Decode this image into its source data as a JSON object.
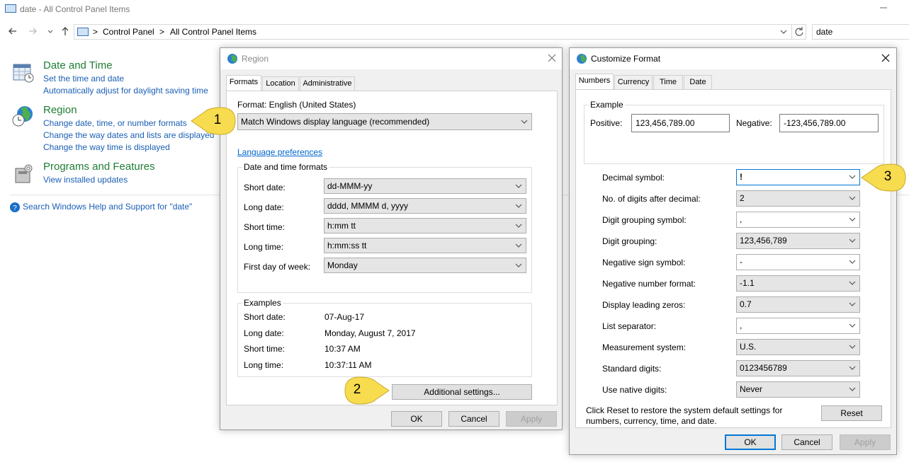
{
  "window": {
    "title": "date - All Control Panel Items"
  },
  "address": {
    "crumbs": [
      "Control Panel",
      "All Control Panel Items"
    ],
    "separator": ">",
    "search_value": "date"
  },
  "left_pane": {
    "sections": [
      {
        "heading": "Date and Time",
        "icon": "calendar-clock-icon",
        "links": [
          "Set the time and date",
          "Automatically adjust for daylight saving time"
        ]
      },
      {
        "heading": "Region",
        "icon": "globe-clock-icon",
        "links": [
          "Change date, time, or number formats",
          "Change the way dates and lists are displayed",
          "Change the way time is displayed"
        ]
      },
      {
        "heading": "Programs and Features",
        "icon": "programs-box-icon",
        "links": [
          "View installed updates"
        ]
      }
    ],
    "help_link": "Search Windows Help and Support for \"date\""
  },
  "region_dialog": {
    "title": "Region",
    "tabs": [
      "Formats",
      "Location",
      "Administrative"
    ],
    "format_label": "Format: English (United States)",
    "format_value": "Match Windows display language (recommended)",
    "language_link": "Language preferences",
    "dt_group_label": "Date and time formats",
    "dt_rows": [
      {
        "label": "Short date:",
        "value": "dd-MMM-yy"
      },
      {
        "label": "Long date:",
        "value": "dddd, MMMM d, yyyy"
      },
      {
        "label": "Short time:",
        "value": "h:mm tt"
      },
      {
        "label": "Long time:",
        "value": "h:mm:ss tt"
      },
      {
        "label": "First day of week:",
        "value": "Monday"
      }
    ],
    "examples_label": "Examples",
    "examples": [
      {
        "label": "Short date:",
        "value": "07-Aug-17"
      },
      {
        "label": "Long date:",
        "value": "Monday, August 7, 2017"
      },
      {
        "label": "Short time:",
        "value": "10:37 AM"
      },
      {
        "label": "Long time:",
        "value": "10:37:11 AM"
      }
    ],
    "additional_button": "Additional settings...",
    "ok": "OK",
    "cancel": "Cancel",
    "apply": "Apply"
  },
  "customize_dialog": {
    "title": "Customize Format",
    "tabs": [
      "Numbers",
      "Currency",
      "Time",
      "Date"
    ],
    "example_label": "Example",
    "positive_label": "Positive:",
    "positive_value": "123,456,789.00",
    "negative_label": "Negative:",
    "negative_value": "-123,456,789.00",
    "rows": [
      {
        "label": "Decimal symbol:",
        "value": "!"
      },
      {
        "label": "No. of digits after decimal:",
        "value": "2"
      },
      {
        "label": "Digit grouping symbol:",
        "value": ","
      },
      {
        "label": "Digit grouping:",
        "value": "123,456,789"
      },
      {
        "label": "Negative sign symbol:",
        "value": "-"
      },
      {
        "label": "Negative number format:",
        "value": "-1.1"
      },
      {
        "label": "Display leading zeros:",
        "value": "0.7"
      },
      {
        "label": "List separator:",
        "value": ","
      },
      {
        "label": "Measurement system:",
        "value": "U.S."
      },
      {
        "label": "Standard digits:",
        "value": "0123456789"
      },
      {
        "label": "Use native digits:",
        "value": "Never"
      }
    ],
    "reset_text_1": "Click Reset to restore the system default settings for",
    "reset_text_2": "numbers, currency, time, and date.",
    "reset": "Reset",
    "ok": "OK",
    "cancel": "Cancel",
    "apply": "Apply"
  },
  "callouts": [
    "1",
    "2",
    "3"
  ],
  "colors": {
    "link": "#1a5fb4",
    "heading_green": "#1e7e34",
    "callout_yellow": "#f7dc4f",
    "focus_blue": "#0078d7"
  }
}
